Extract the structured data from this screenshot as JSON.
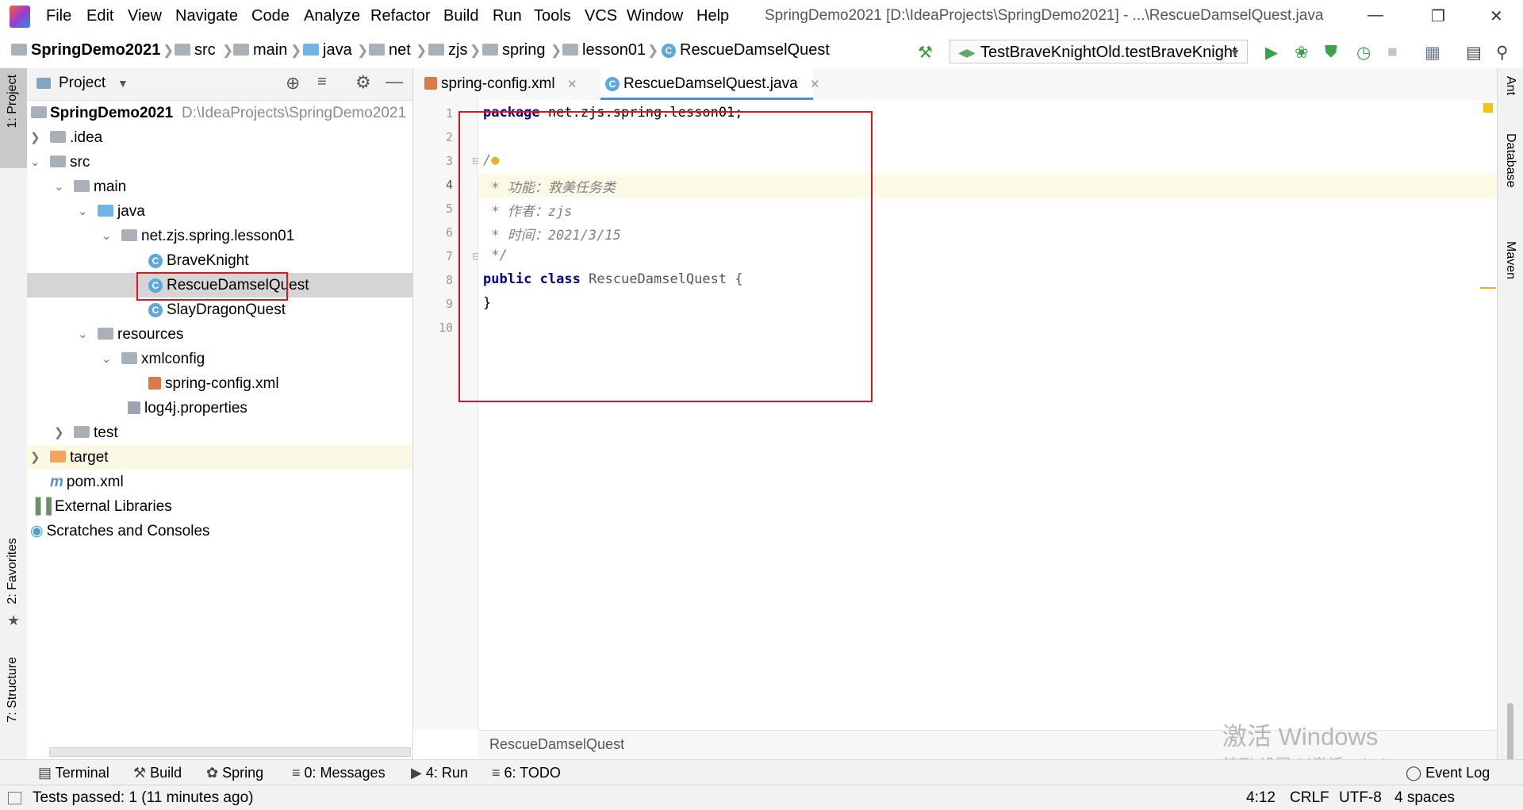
{
  "titlebar": {
    "menus": [
      "File",
      "Edit",
      "View",
      "Navigate",
      "Code",
      "Analyze",
      "Refactor",
      "Build",
      "Run",
      "Tools",
      "VCS",
      "Window",
      "Help"
    ],
    "window_title": "SpringDemo2021 [D:\\IdeaProjects\\SpringDemo2021] - ...\\RescueDamselQuest.java"
  },
  "navbar": {
    "crumbs": [
      "SpringDemo2021",
      "src",
      "main",
      "java",
      "net",
      "zjs",
      "spring",
      "lesson01",
      "RescueDamselQuest"
    ],
    "run_config": "TestBraveKnightOld.testBraveKnight"
  },
  "leftstrip": {
    "project": "1: Project",
    "favorites": "2: Favorites",
    "structure": "7: Structure"
  },
  "rightstrip": {
    "ant": "Ant",
    "database": "Database",
    "maven": "Maven"
  },
  "project": {
    "header": "Project",
    "root_name": "SpringDemo2021",
    "root_path": "D:\\IdeaProjects\\SpringDemo2021",
    "items": [
      ".idea",
      "src",
      "main",
      "java",
      "net.zjs.spring.lesson01",
      "BraveKnight",
      "RescueDamselQuest",
      "SlayDragonQuest",
      "resources",
      "xmlconfig",
      "spring-config.xml",
      "log4j.properties",
      "test",
      "target",
      "pom.xml",
      "External Libraries",
      "Scratches and Consoles"
    ]
  },
  "editor": {
    "tabs": [
      "spring-config.xml",
      "RescueDamselQuest.java"
    ],
    "line_numbers": [
      "1",
      "2",
      "3",
      "4",
      "5",
      "6",
      "7",
      "8",
      "9",
      "10"
    ],
    "code": {
      "l1_kw": "package",
      "l1_rest": " net.zjs.spring.lesson01;",
      "l3": "/",
      "l4": " * 功能：救美任务类",
      "l5": " * 作者：zjs",
      "l6": " * 时间：2021/3/15",
      "l7": " */",
      "l8_kw1": "public",
      "l8_kw2": "class",
      "l8_rest": " RescueDamselQuest {",
      "l9": "}"
    },
    "bottom_breadcrumb": "RescueDamselQuest"
  },
  "toolwindows": {
    "terminal": "Terminal",
    "build": "Build",
    "spring": "Spring",
    "messages": "0: Messages",
    "run": "4: Run",
    "todo": "6: TODO",
    "event_log": "Event Log"
  },
  "status": {
    "message": "Tests passed: 1 (11 minutes ago)",
    "position": "4:12",
    "line_sep": "CRLF",
    "encoding": "UTF-8",
    "indent": "4 spaces"
  },
  "watermark": {
    "line1": "激活 Windows",
    "line2": "转到“设置”以激活 Windows。"
  },
  "colors": {
    "accent": "#4a90d9",
    "selection": "#d5d5d5",
    "redbox": "#e0141e",
    "keyword": "#000080",
    "comment": "#808080"
  }
}
